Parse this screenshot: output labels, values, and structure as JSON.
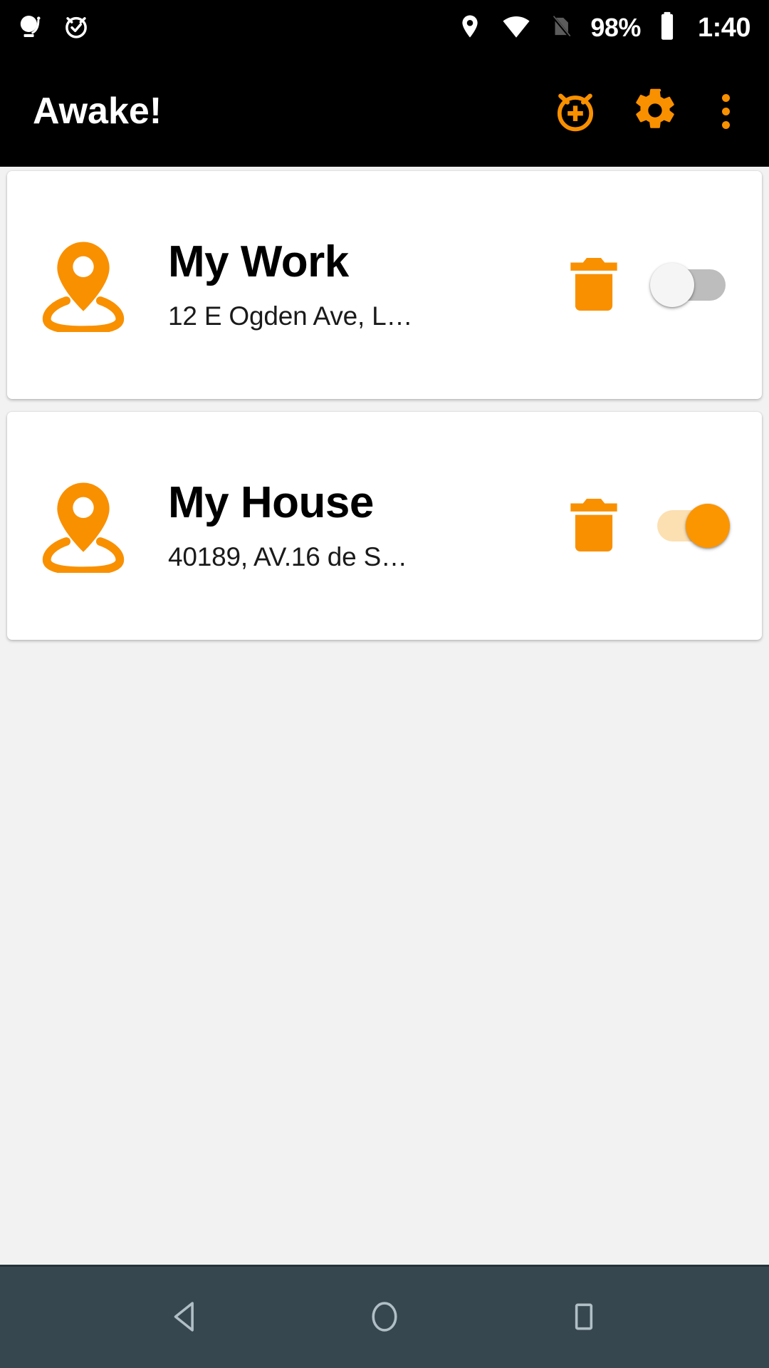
{
  "status_bar": {
    "background": "#000000",
    "left_icons": [
      {
        "name": "do-not-disturb-icon",
        "label": "notification"
      },
      {
        "name": "alarm-set-icon",
        "label": "alarm"
      }
    ],
    "right_icons": [
      {
        "name": "location-icon",
        "label": "location"
      },
      {
        "name": "wifi-icon",
        "label": "wifi"
      },
      {
        "name": "no-sim-icon",
        "label": "no sim"
      }
    ],
    "battery_percent": "98%",
    "time": "1:40"
  },
  "app_bar": {
    "title": "Awake!",
    "title_color": "#ffffff",
    "background": "#000000",
    "accent": "#f99000",
    "actions": [
      {
        "name": "add-alarm-icon",
        "label": "Add alarm"
      },
      {
        "name": "gear-icon",
        "label": "Settings"
      },
      {
        "name": "overflow-menu-icon",
        "label": "More options"
      }
    ]
  },
  "locations": [
    {
      "title": "My Work",
      "address": "12 E Ogden Ave, L…",
      "pin_icon": "location-pin-icon",
      "delete_icon": "trash-icon",
      "enabled": false,
      "toggle_state": "off"
    },
    {
      "title": "My House",
      "address": "40189, AV.16 de S…",
      "pin_icon": "location-pin-icon",
      "delete_icon": "trash-icon",
      "enabled": true,
      "toggle_state": "on"
    }
  ],
  "nav_bar": {
    "background": "#37474f",
    "buttons": [
      {
        "name": "back-button",
        "label": "Back"
      },
      {
        "name": "home-button",
        "label": "Home"
      },
      {
        "name": "recents-button",
        "label": "Recents"
      }
    ]
  },
  "colors": {
    "accent_orange": "#f99000",
    "toggle_on_thumb": "#fb9500",
    "toggle_on_track": "#fce0b2",
    "toggle_off_track": "#bdbdbd",
    "toggle_off_thumb": "#f5f5f5",
    "page_background": "#f2f2f2",
    "card_background": "#ffffff",
    "nav_background": "#37474f"
  }
}
